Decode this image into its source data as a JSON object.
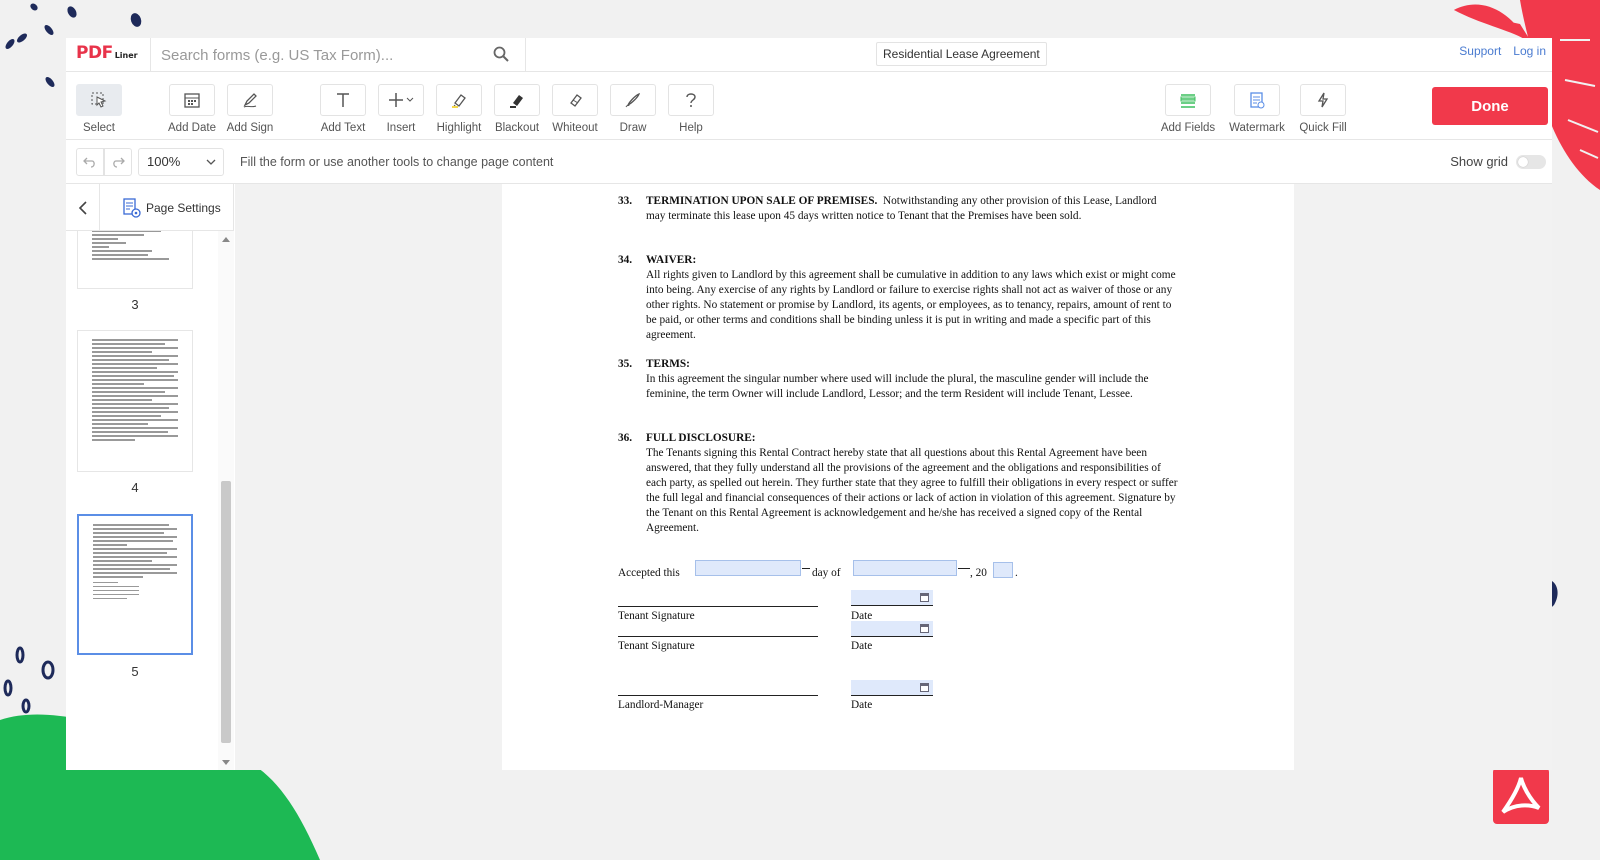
{
  "header": {
    "logo_main": "PDF",
    "logo_sub": "Liner",
    "search_placeholder": "Search forms (e.g. US Tax Form)...",
    "document_title": "Residential Lease Agreement",
    "support_label": "Support",
    "login_label": "Log in"
  },
  "toolbar": {
    "tools": [
      {
        "label": "Select",
        "icon": "cursor-icon"
      },
      {
        "label": "Add Date",
        "icon": "calendar-icon"
      },
      {
        "label": "Add Sign",
        "icon": "pen-sign-icon"
      },
      {
        "label": "Add Text",
        "icon": "text-icon"
      },
      {
        "label": "Insert",
        "icon": "plus-icon"
      },
      {
        "label": "Highlight",
        "icon": "highlighter-icon"
      },
      {
        "label": "Blackout",
        "icon": "blackout-icon"
      },
      {
        "label": "Whiteout",
        "icon": "eraser-icon"
      },
      {
        "label": "Draw",
        "icon": "brush-icon"
      },
      {
        "label": "Help",
        "icon": "question-icon"
      },
      {
        "label": "Add Fields",
        "icon": "fields-icon"
      },
      {
        "label": "Watermark",
        "icon": "watermark-icon"
      },
      {
        "label": "Quick Fill",
        "icon": "lightning-icon"
      }
    ],
    "done_label": "Done",
    "accent_color": "#f1394b"
  },
  "subbar": {
    "zoom": "100%",
    "hint": "Fill the form or use another tools to change page content",
    "show_grid_label": "Show grid",
    "show_grid_on": false
  },
  "sidebar": {
    "page_settings_label": "Page Settings",
    "pages": [
      "3",
      "4",
      "5"
    ],
    "selected_page": "5"
  },
  "document": {
    "sections": [
      {
        "num": "33.",
        "title": "TERMINATION UPON SALE OF PREMISES.",
        "body": "Notwithstanding any other provision of this Lease, Landlord may terminate this lease upon 45 days written notice to Tenant that the Premises have been sold."
      },
      {
        "num": "34.",
        "title": "WAIVER:",
        "body": "All rights given to Landlord by this agreement shall be cumulative in addition to any laws which exist or might come into being.  Any exercise of any rights by Landlord or failure to exercise rights shall not act as waiver of those or any other rights.  No statement or promise by Landlord, its agents, or employees, as to tenancy, repairs, amount of rent to be paid, or other terms and conditions shall be binding unless it is put in writing and made a specific part of this agreement."
      },
      {
        "num": "35.",
        "title": "TERMS:",
        "body": "In this agreement the singular number where used will include the plural, the masculine gender will include the feminine, the term Owner will include Landlord, Lessor; and the term Resident will include Tenant, Lessee."
      },
      {
        "num": "36.",
        "title": "FULL DISCLOSURE:",
        "body": "The Tenants signing this Rental Contract hereby state that all questions about this Rental Agreement have been answered, that they fully understand all the provisions of the agreement and the obligations and responsibilities of each party, as spelled out herein.  They further state that they agree to fulfill their obligations in every respect or suffer the full legal and financial consequences of their actions or lack of action in violation of this agreement.  Signature by the Tenant on this Rental Agreement is acknowledgement and he/she has received a signed copy of the Rental Agreement."
      }
    ],
    "accepted_prefix": "Accepted this",
    "day_of": "day of",
    "year_prefix": ", 20",
    "period": ".",
    "tenant_signature_label": "Tenant Signature",
    "date_label": "Date",
    "landlord_label": "Landlord-Manager"
  }
}
